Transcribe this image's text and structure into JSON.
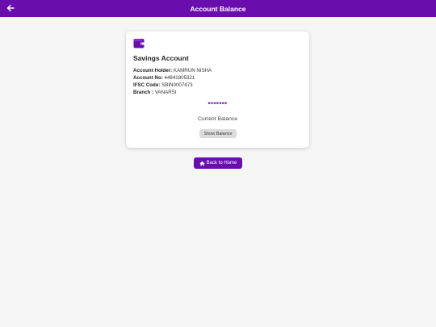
{
  "header": {
    "title": "Account Balance",
    "back_icon": "arrow-left-icon"
  },
  "card": {
    "icon": "wallet-icon",
    "account_type": "Savings Account",
    "holder_label": "Account Holder:",
    "holder_value": " KAMRUN NISHA",
    "number_label": "Account No:",
    "number_value": " 44841805321",
    "ifsc_label": "IFSC Code:",
    "ifsc_value": " SBIN0007473",
    "branch_label": "Branch :",
    "branch_value": " VANARSI",
    "masked_balance": "*******",
    "balance_label": "Current Balance",
    "show_button": "Show Balance"
  },
  "home_button": {
    "icon": "home-icon",
    "label": "Back to Home"
  },
  "colors": {
    "primary": "#6a0dad",
    "background": "#f5f5f5",
    "button_gray": "#dcdcdc"
  }
}
